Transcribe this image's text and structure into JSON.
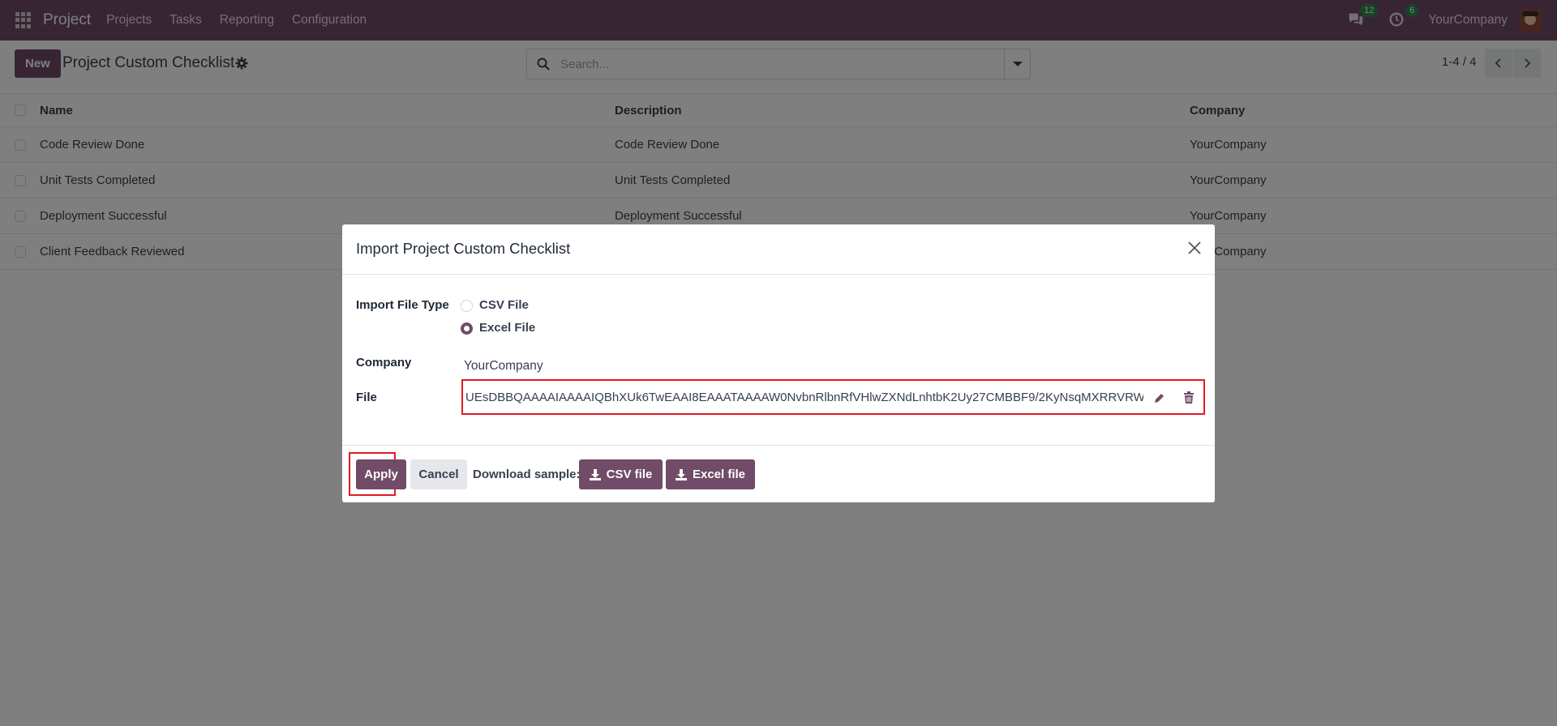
{
  "navbar": {
    "app_name": "Project",
    "menu": [
      "Projects",
      "Tasks",
      "Reporting",
      "Configuration"
    ],
    "messages_badge": "12",
    "activities_badge": "6",
    "company": "YourCompany",
    "icons": {
      "apps": "apps-grid-icon",
      "messages": "chat-icon",
      "activities": "clock-icon"
    }
  },
  "control": {
    "new_label": "New",
    "title": "Project Custom Checklist",
    "search_placeholder": "Search...",
    "pager": "1-4 / 4"
  },
  "list": {
    "headers": [
      "Name",
      "Description",
      "Company"
    ],
    "rows": [
      [
        "Code Review Done",
        "Code Review Done",
        "YourCompany"
      ],
      [
        "Unit Tests Completed",
        "Unit Tests Completed",
        "YourCompany"
      ],
      [
        "Deployment Successful",
        "Deployment Successful",
        "YourCompany"
      ],
      [
        "Client Feedback Reviewed",
        "",
        "YourCompany"
      ]
    ]
  },
  "modal": {
    "title": "Import Project Custom Checklist",
    "import_type_label": "Import File Type",
    "options": [
      "CSV File",
      "Excel File"
    ],
    "selected_option": "Excel File",
    "company_label": "Company",
    "company_value": "YourCompany",
    "file_label": "File",
    "file_value": "UEsDBBQAAAAIAAAAIQBhXUk6TwEAAI8EAAATAAAAW0NvbnRlbnRfVHlwZXNdLnhtbK2Uy27CMBBF9/2KyNsqMXRRVRW",
    "apply_label": "Apply",
    "cancel_label": "Cancel",
    "download_label": "Download sample:",
    "csv_button": "CSV file",
    "excel_button": "Excel file"
  },
  "colors": {
    "brand": "#714B67",
    "highlight": "#e01b24"
  }
}
